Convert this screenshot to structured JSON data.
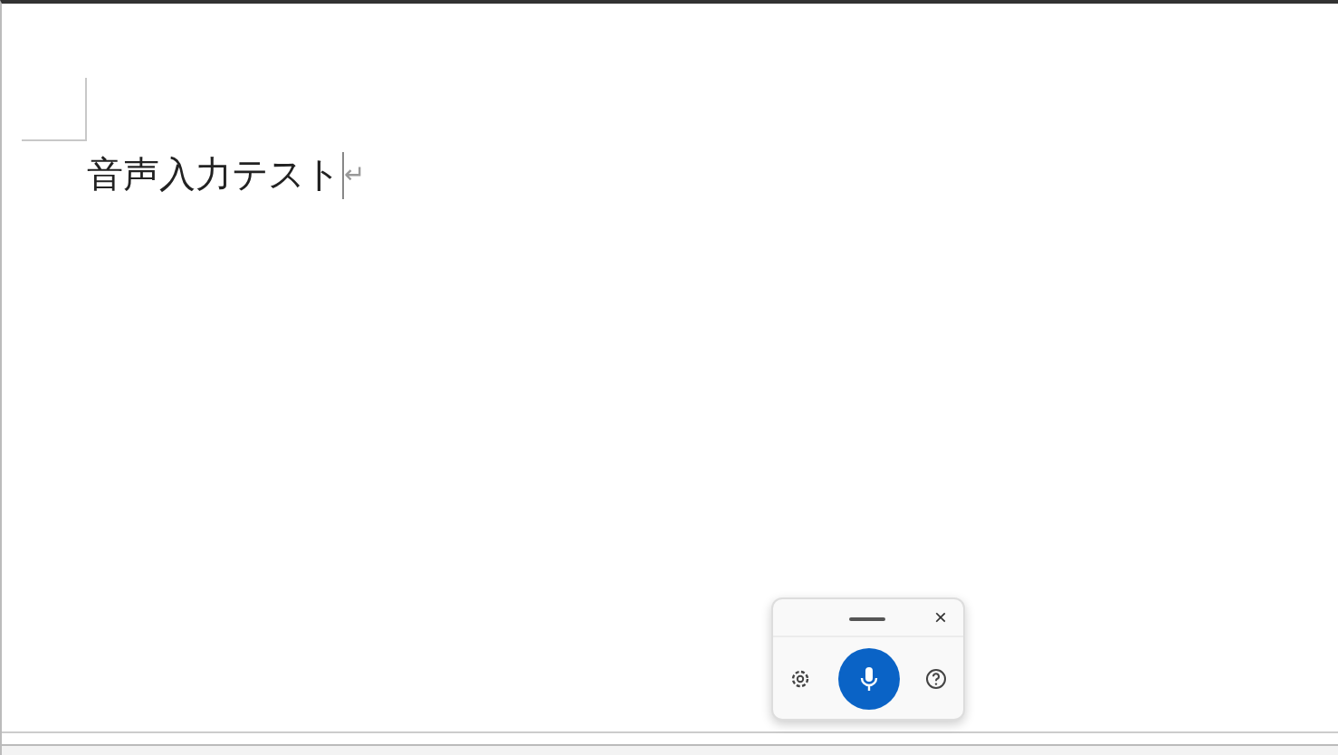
{
  "document": {
    "paragraphs": [
      {
        "text": "音声入力テスト",
        "mark": "↵"
      }
    ]
  },
  "voice_toolbar": {
    "close": "×"
  }
}
